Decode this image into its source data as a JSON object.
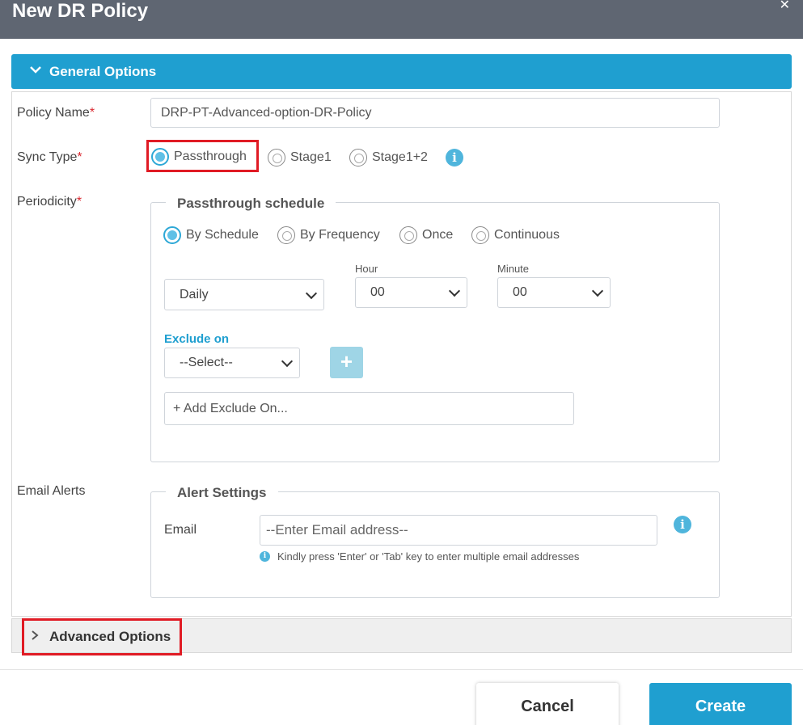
{
  "dialog": {
    "title": "New DR Policy",
    "close_icon": "close-icon"
  },
  "general": {
    "header": "General Options",
    "policy_name": {
      "label": "Policy Name",
      "required": "*",
      "value": "DRP-PT-Advanced-option-DR-Policy"
    },
    "sync_type": {
      "label": "Sync Type",
      "required": "*",
      "options": [
        "Passthrough",
        "Stage1",
        "Stage1+2"
      ],
      "selected": "Passthrough"
    },
    "periodicity": {
      "label": "Periodicity",
      "required": "*",
      "legend": "Passthrough schedule",
      "modes": [
        "By Schedule",
        "By Frequency",
        "Once",
        "Continuous"
      ],
      "selected_mode": "By Schedule",
      "interval": "Daily",
      "hour_label": "Hour",
      "hour": "00",
      "minute_label": "Minute",
      "minute": "00",
      "exclude_label": "Exclude on",
      "exclude_select": "--Select--",
      "exclude_placeholder": "+ Add Exclude On..."
    },
    "email_alerts": {
      "label": "Email Alerts",
      "legend": "Alert Settings",
      "email_label": "Email",
      "email_placeholder": "--Enter Email address--",
      "hint": "Kindly press 'Enter' or 'Tab' key to enter multiple email addresses"
    }
  },
  "advanced": {
    "header": "Advanced Options"
  },
  "footer": {
    "cancel": "Cancel",
    "create": "Create"
  },
  "colors": {
    "accent": "#1f9fd0",
    "titlebar": "#5f6672",
    "required": "#d9262e",
    "highlight": "#e01b24"
  }
}
